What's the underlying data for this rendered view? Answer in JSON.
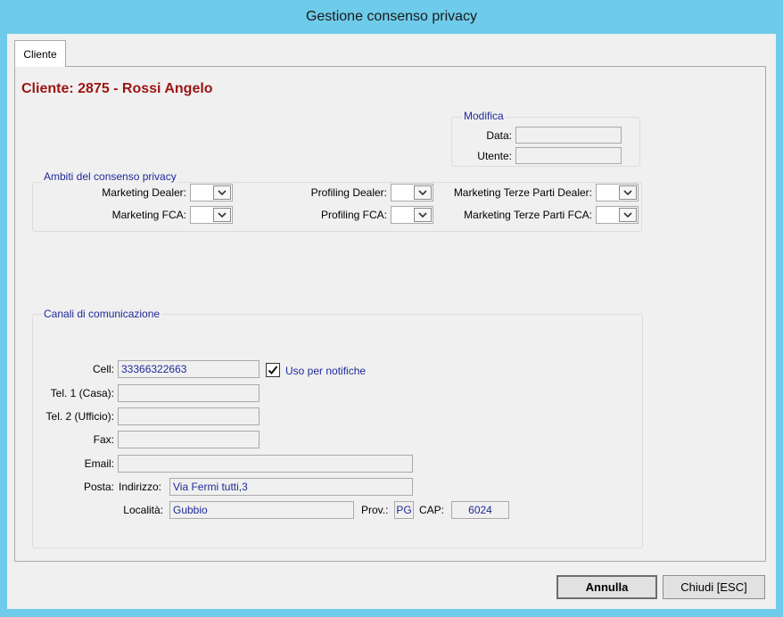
{
  "window": {
    "title": "Gestione consenso privacy"
  },
  "tabs": [
    {
      "label": "Cliente"
    }
  ],
  "customer": {
    "title": "Cliente: 2875 - Rossi Angelo"
  },
  "modifica": {
    "legend": "Modifica",
    "data_label": "Data:",
    "data_value": "",
    "utente_label": "Utente:",
    "utente_value": ""
  },
  "ambiti": {
    "legend": "Ambiti del consenso privacy",
    "marketing_dealer": "Marketing Dealer:",
    "marketing_fca": "Marketing FCA:",
    "profiling_dealer": "Profiling Dealer:",
    "profiling_fca": "Profiling FCA:",
    "mtp_dealer": "Marketing Terze Parti Dealer:",
    "mtp_fca": "Marketing Terze Parti FCA:"
  },
  "canali": {
    "legend": "Canali di comunicazione",
    "cell_label": "Cell:",
    "cell_value": "33366322663",
    "uso_notifiche_label": "Uso per notifiche",
    "uso_notifiche_checked": true,
    "tel1_label": "Tel. 1 (Casa):",
    "tel1_value": "",
    "tel2_label": "Tel. 2 (Ufficio):",
    "tel2_value": "",
    "fax_label": "Fax:",
    "fax_value": "",
    "email_label": "Email:",
    "email_value": "",
    "posta_label": "Posta:",
    "indirizzo_label": "Indirizzo:",
    "indirizzo_value": "Via Fermi tutti,3",
    "localita_label": "Località:",
    "localita_value": "Gubbio",
    "prov_label": "Prov.:",
    "prov_value": "PG",
    "cap_label": "CAP:",
    "cap_value": "6024"
  },
  "buttons": {
    "annulla": "Annulla",
    "chiudi": "Chiudi [ESC]"
  }
}
